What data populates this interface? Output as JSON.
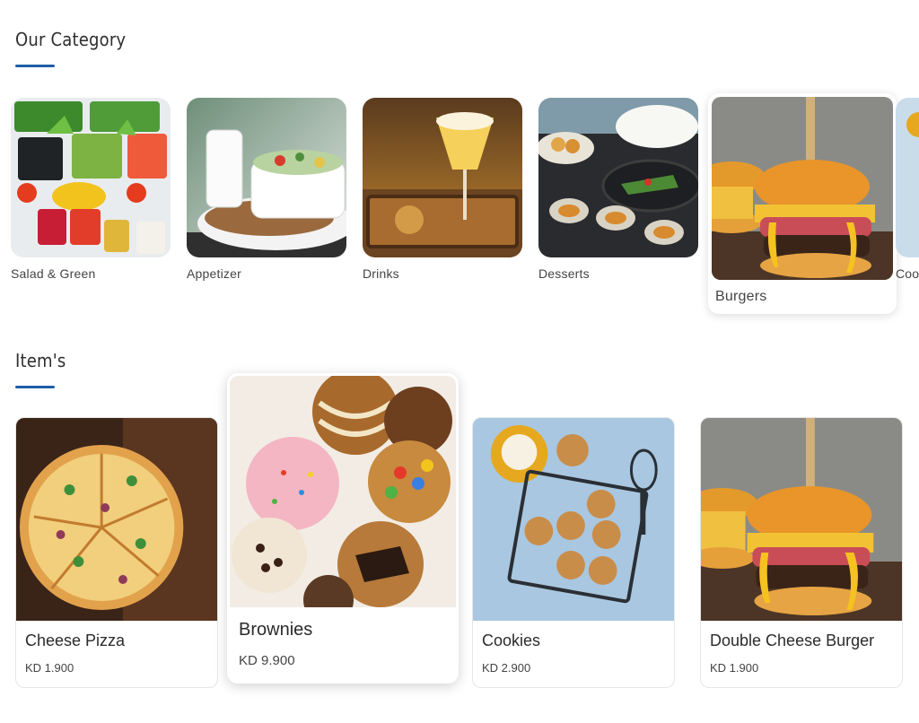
{
  "category_section": {
    "title": "Our Category"
  },
  "categories": [
    {
      "label": "Salad & Green"
    },
    {
      "label": "Appetizer"
    },
    {
      "label": "Drinks"
    },
    {
      "label": "Desserts"
    },
    {
      "label": "Burgers",
      "selected": true
    },
    {
      "label": "Coo"
    }
  ],
  "items_section": {
    "title": "Item's"
  },
  "items": [
    {
      "name": "Cheese Pizza",
      "price": "KD 1.900"
    },
    {
      "name": "Brownies",
      "price": "KD 9.900",
      "selected": true
    },
    {
      "name": "Cookies",
      "price": "KD 2.900"
    },
    {
      "name": "Double Cheese Burger",
      "price": "KD 1.900"
    }
  ],
  "colors": {
    "accent": "#1f5ea8",
    "text": "#2b2b2b",
    "card_border": "#e6e6e6"
  }
}
